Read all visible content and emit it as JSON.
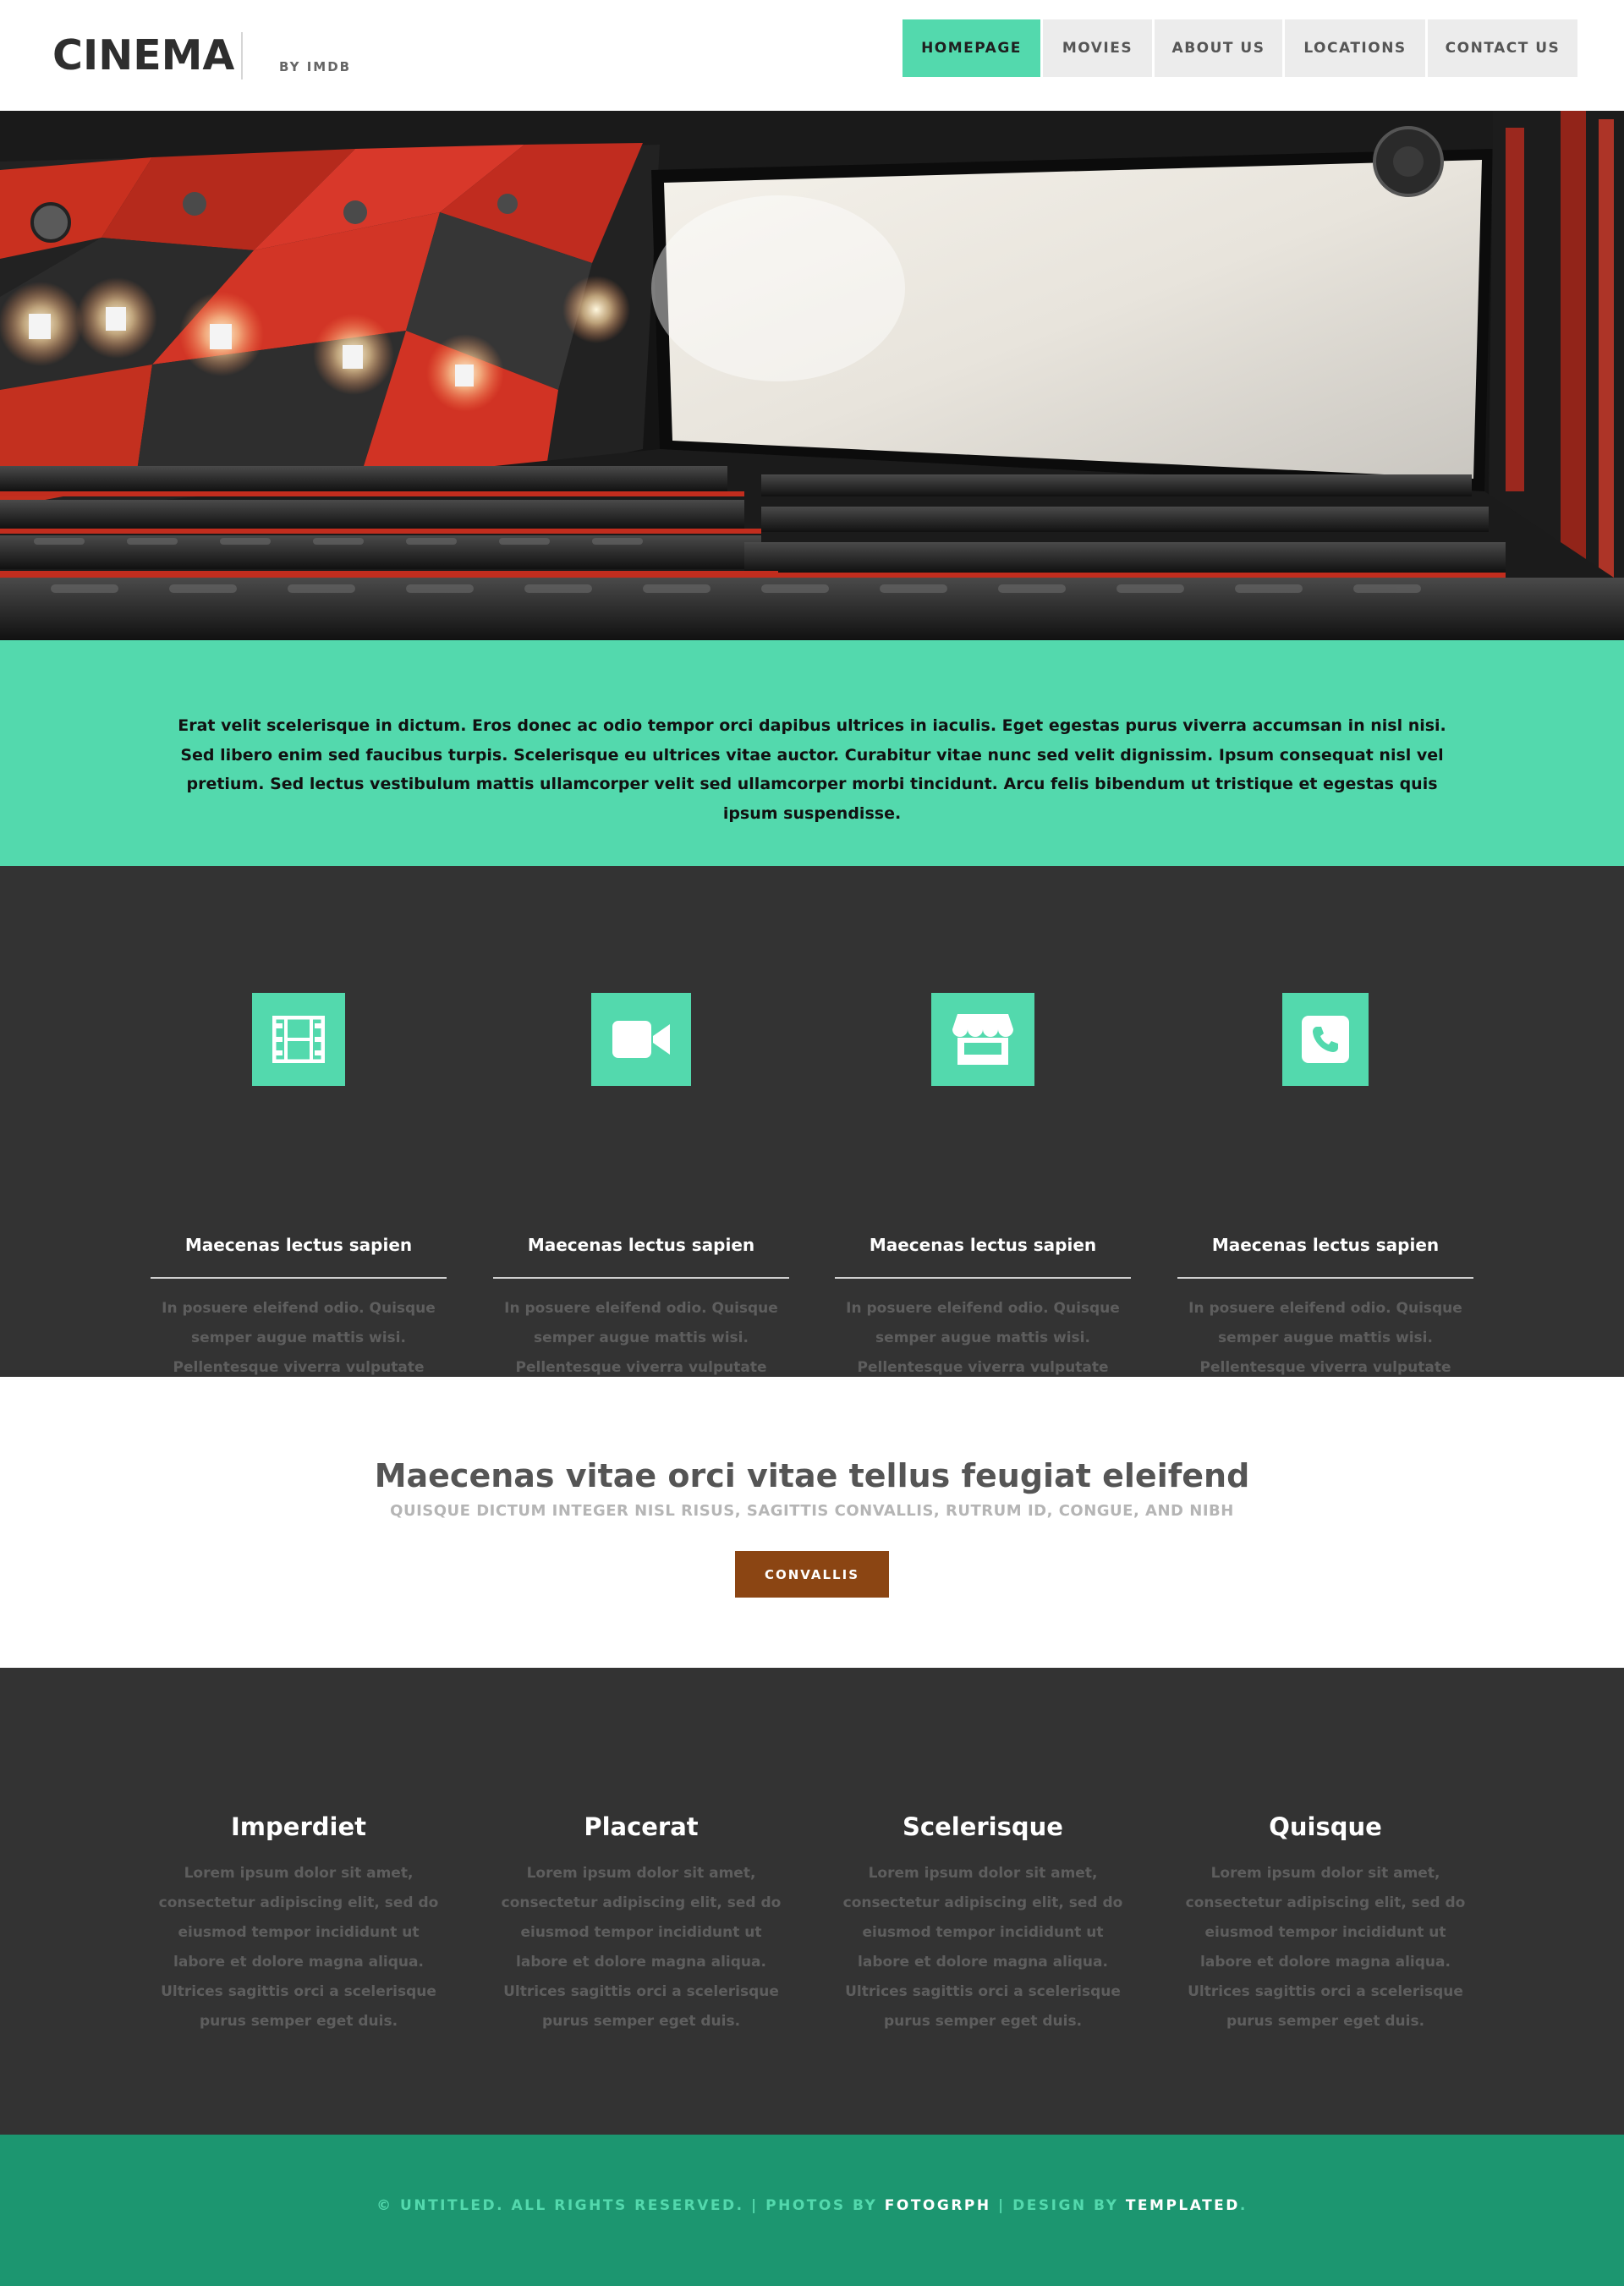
{
  "header": {
    "logo": "CINEMA",
    "logo_sub": "BY IMDB",
    "nav": [
      {
        "label": "HOMEPAGE",
        "active": true
      },
      {
        "label": "MOVIES",
        "active": false
      },
      {
        "label": "ABOUT US",
        "active": false
      },
      {
        "label": "LOCATIONS",
        "active": false
      },
      {
        "label": "CONTACT US",
        "active": false
      }
    ]
  },
  "intro": {
    "text": "Erat velit scelerisque in dictum. Eros donec ac odio tempor orci dapibus ultrices in iaculis. Eget egestas purus viverra accumsan in nisl nisi. Sed libero enim sed faucibus turpis. Scelerisque eu ultrices vitae auctor. Curabitur vitae nunc sed velit dignissim. Ipsum consequat nisl vel pretium. Sed lectus vestibulum mattis ullamcorper velit sed ullamcorper morbi tincidunt. Arcu felis bibendum ut tristique et egestas quis ipsum suspendisse."
  },
  "features": [
    {
      "icon": "film-icon",
      "title": "Maecenas lectus sapien",
      "text": "In posuere eleifend odio. Quisque semper augue mattis wisi. Pellentesque viverra vulputate enim. Aliquam erat volutpat."
    },
    {
      "icon": "video-camera-icon",
      "title": "Maecenas lectus sapien",
      "text": "In posuere eleifend odio. Quisque semper augue mattis wisi. Pellentesque viverra vulputate enim. Aliquam erat volutpat."
    },
    {
      "icon": "storefront-icon",
      "title": "Maecenas lectus sapien",
      "text": "In posuere eleifend odio. Quisque semper augue mattis wisi. Pellentesque viverra vulputate enim. Aliquam erat volutpat."
    },
    {
      "icon": "phone-icon",
      "title": "Maecenas lectus sapien",
      "text": "In posuere eleifend odio. Quisque semper augue mattis wisi. Pellentesque viverra vulputate enim. Aliquam erat volutpat."
    }
  ],
  "cta": {
    "heading": "Maecenas vitae orci vitae tellus feugiat eleifend",
    "subheading": "QUISQUE DICTUM INTEGER NISL RISUS, SAGITTIS CONVALLIS, RUTRUM ID, CONGUE, AND NIBH",
    "button": "CONVALLIS"
  },
  "columns": [
    {
      "title": "Imperdiet",
      "text": "Lorem ipsum dolor sit amet, consectetur adipiscing elit, sed do eiusmod tempor incididunt ut labore et dolore magna aliqua. Ultrices sagittis orci a scelerisque purus semper eget duis."
    },
    {
      "title": "Placerat",
      "text": "Lorem ipsum dolor sit amet, consectetur adipiscing elit, sed do eiusmod tempor incididunt ut labore et dolore magna aliqua. Ultrices sagittis orci a scelerisque purus semper eget duis."
    },
    {
      "title": "Scelerisque",
      "text": "Lorem ipsum dolor sit amet, consectetur adipiscing elit, sed do eiusmod tempor incididunt ut labore et dolore magna aliqua. Ultrices sagittis orci a scelerisque purus semper eget duis."
    },
    {
      "title": "Quisque",
      "text": "Lorem ipsum dolor sit amet, consectetur adipiscing elit, sed do eiusmod tempor incididunt ut labore et dolore magna aliqua. Ultrices sagittis orci a scelerisque purus semper eget duis."
    }
  ],
  "footer": {
    "copyright": "© UNTITLED. ALL RIGHTS RESERVED. | PHOTOS BY ",
    "photos_link": "FOTOGRPH",
    "design_sep": " | DESIGN BY ",
    "design_link": "TEMPLATED",
    "end": "."
  },
  "colors": {
    "accent": "#53d9ad",
    "dark": "#333333",
    "button": "#8b4513",
    "footer": "#1c9670"
  }
}
